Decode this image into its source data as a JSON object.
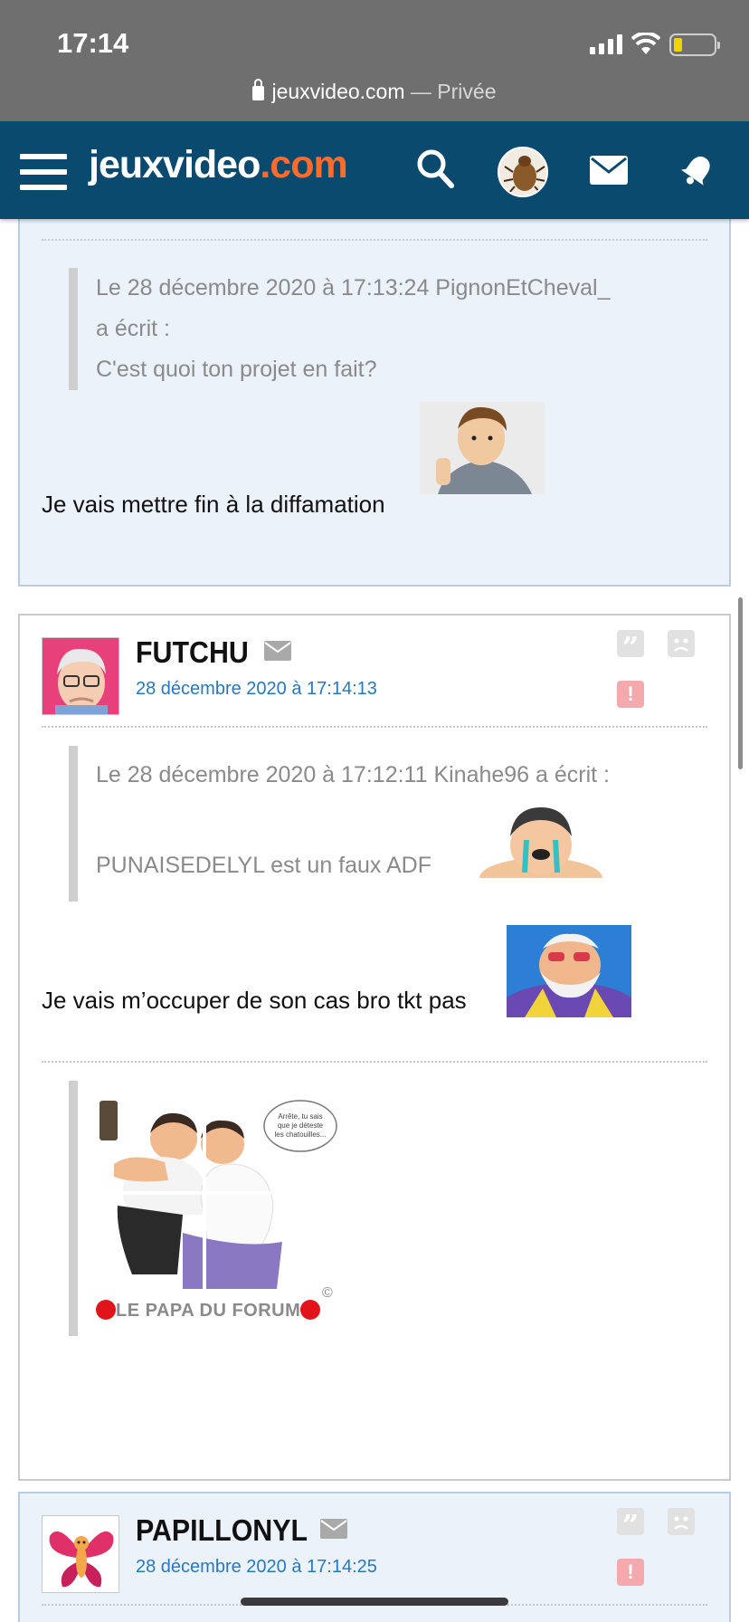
{
  "status": {
    "time": "17:14",
    "battery_color": "#f0d400"
  },
  "browser": {
    "domain": "jeuxvideo.com",
    "separator": " — ",
    "mode": "Privée"
  },
  "header": {
    "logo_main": "jeuxvideo",
    "logo_suffix": ".com",
    "brand_color": "#0a4a6e",
    "accent_color": "#ff6b2b",
    "icons": [
      "menu-icon",
      "search-icon",
      "user-avatar",
      "mail-icon",
      "notification-bell-icon"
    ]
  },
  "posts": [
    {
      "quote_line1": "Le 28 décembre 2020 à 17:13:24 PignonEtCheval_",
      "quote_line2": "a écrit :",
      "quote_line3": "C'est quoi ton projet en fait?",
      "message": "Je vais mettre fin à la diffamation"
    },
    {
      "author": "FUTCHU",
      "date": "28 décembre 2020 à 17:14:13",
      "quote_line1": "Le 28 décembre 2020 à 17:12:11 Kinahe96 a écrit :",
      "quote_line2": "PUNAISEDELYL est un faux ADF",
      "message": "Je vais m’occuper de son cas bro tkt pas",
      "signature": "LE PAPA DU FORUM",
      "signature_bubble": "Arrête, tu sais que je déteste les chatouilles...",
      "copyright": "©"
    },
    {
      "author": "PAPILLONYL",
      "date": "28 décembre 2020 à 17:14:25"
    }
  ],
  "actions": {
    "quote_symbol": "”",
    "alert_symbol": "!"
  }
}
